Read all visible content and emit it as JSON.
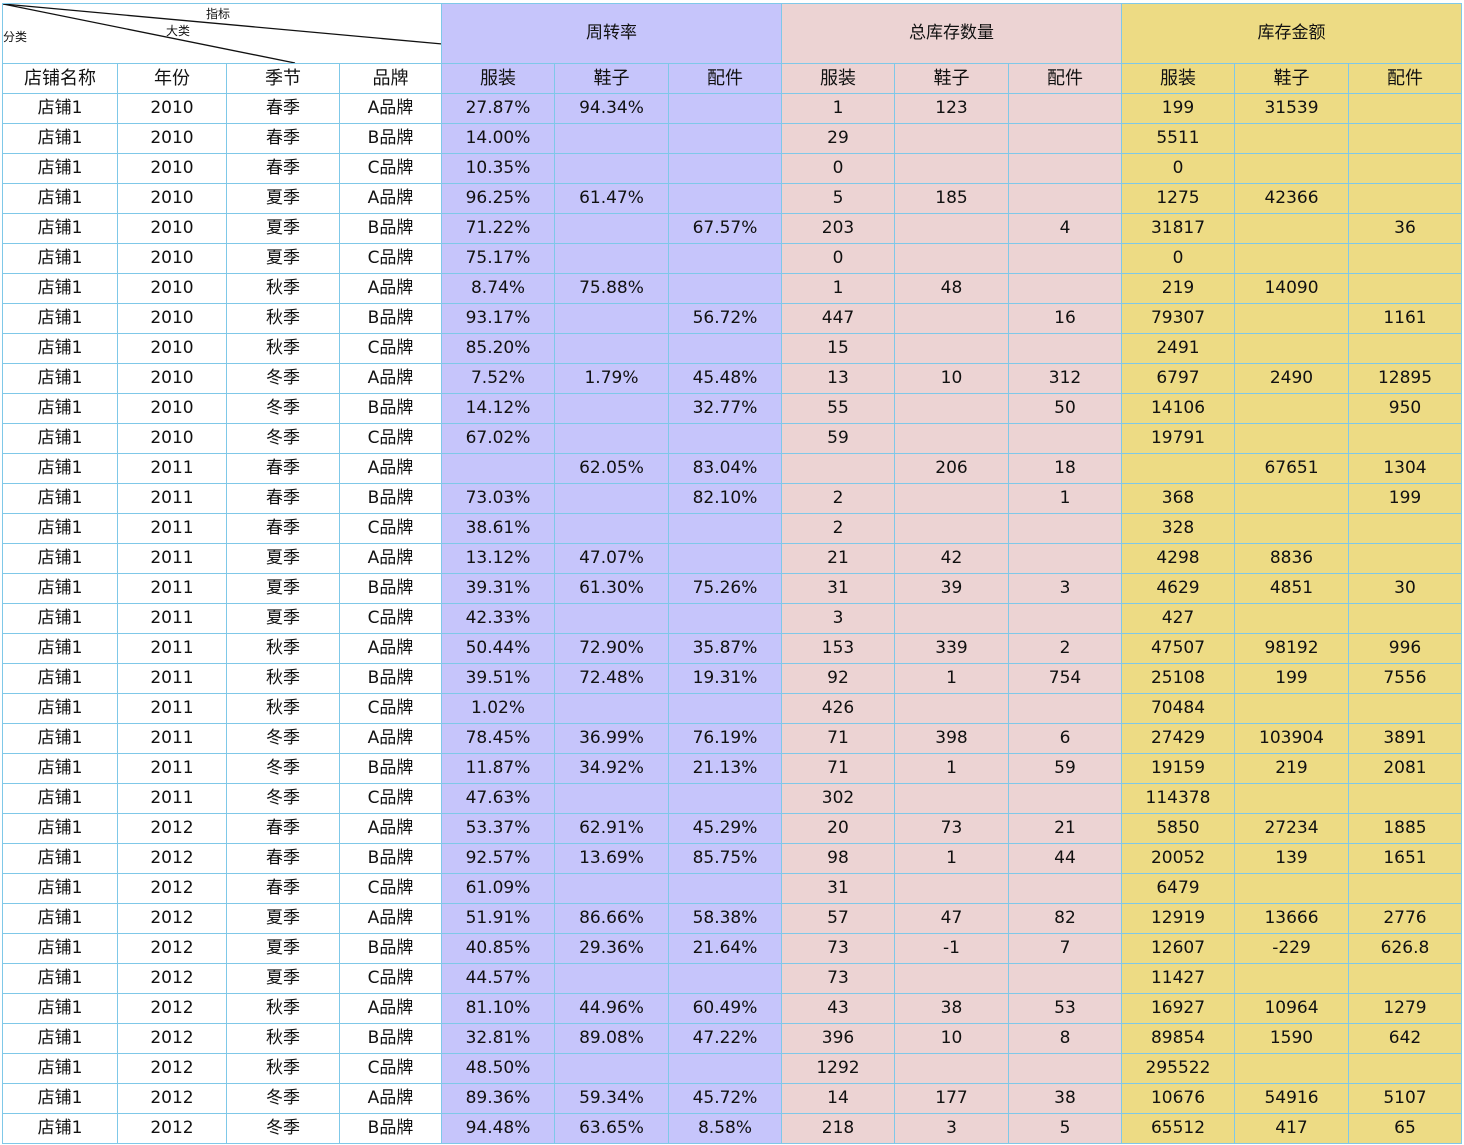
{
  "header": {
    "corner": {
      "zhibiao": "指标",
      "dalei": "大类",
      "fenlei": "分类"
    },
    "groups": [
      "周转率",
      "总库存数量",
      "库存金额"
    ],
    "dims": [
      "店铺名称",
      "年份",
      "季节",
      "品牌"
    ],
    "subs": [
      "服装",
      "鞋子",
      "配件",
      "服装",
      "鞋子",
      "配件",
      "服装",
      "鞋子",
      "配件"
    ]
  },
  "rows": [
    [
      "店铺1",
      "2010",
      "春季",
      "A品牌",
      "27.87%",
      "94.34%",
      "",
      "1",
      "123",
      "",
      "199",
      "31539",
      ""
    ],
    [
      "店铺1",
      "2010",
      "春季",
      "B品牌",
      "14.00%",
      "",
      "",
      "29",
      "",
      "",
      "5511",
      "",
      ""
    ],
    [
      "店铺1",
      "2010",
      "春季",
      "C品牌",
      "10.35%",
      "",
      "",
      "0",
      "",
      "",
      "0",
      "",
      ""
    ],
    [
      "店铺1",
      "2010",
      "夏季",
      "A品牌",
      "96.25%",
      "61.47%",
      "",
      "5",
      "185",
      "",
      "1275",
      "42366",
      ""
    ],
    [
      "店铺1",
      "2010",
      "夏季",
      "B品牌",
      "71.22%",
      "",
      "67.57%",
      "203",
      "",
      "4",
      "31817",
      "",
      "36"
    ],
    [
      "店铺1",
      "2010",
      "夏季",
      "C品牌",
      "75.17%",
      "",
      "",
      "0",
      "",
      "",
      "0",
      "",
      ""
    ],
    [
      "店铺1",
      "2010",
      "秋季",
      "A品牌",
      "8.74%",
      "75.88%",
      "",
      "1",
      "48",
      "",
      "219",
      "14090",
      ""
    ],
    [
      "店铺1",
      "2010",
      "秋季",
      "B品牌",
      "93.17%",
      "",
      "56.72%",
      "447",
      "",
      "16",
      "79307",
      "",
      "1161"
    ],
    [
      "店铺1",
      "2010",
      "秋季",
      "C品牌",
      "85.20%",
      "",
      "",
      "15",
      "",
      "",
      "2491",
      "",
      ""
    ],
    [
      "店铺1",
      "2010",
      "冬季",
      "A品牌",
      "7.52%",
      "1.79%",
      "45.48%",
      "13",
      "10",
      "312",
      "6797",
      "2490",
      "12895"
    ],
    [
      "店铺1",
      "2010",
      "冬季",
      "B品牌",
      "14.12%",
      "",
      "32.77%",
      "55",
      "",
      "50",
      "14106",
      "",
      "950"
    ],
    [
      "店铺1",
      "2010",
      "冬季",
      "C品牌",
      "67.02%",
      "",
      "",
      "59",
      "",
      "",
      "19791",
      "",
      ""
    ],
    [
      "店铺1",
      "2011",
      "春季",
      "A品牌",
      "",
      "62.05%",
      "83.04%",
      "",
      "206",
      "18",
      "",
      "67651",
      "1304"
    ],
    [
      "店铺1",
      "2011",
      "春季",
      "B品牌",
      "73.03%",
      "",
      "82.10%",
      "2",
      "",
      "1",
      "368",
      "",
      "199"
    ],
    [
      "店铺1",
      "2011",
      "春季",
      "C品牌",
      "38.61%",
      "",
      "",
      "2",
      "",
      "",
      "328",
      "",
      ""
    ],
    [
      "店铺1",
      "2011",
      "夏季",
      "A品牌",
      "13.12%",
      "47.07%",
      "",
      "21",
      "42",
      "",
      "4298",
      "8836",
      ""
    ],
    [
      "店铺1",
      "2011",
      "夏季",
      "B品牌",
      "39.31%",
      "61.30%",
      "75.26%",
      "31",
      "39",
      "3",
      "4629",
      "4851",
      "30"
    ],
    [
      "店铺1",
      "2011",
      "夏季",
      "C品牌",
      "42.33%",
      "",
      "",
      "3",
      "",
      "",
      "427",
      "",
      ""
    ],
    [
      "店铺1",
      "2011",
      "秋季",
      "A品牌",
      "50.44%",
      "72.90%",
      "35.87%",
      "153",
      "339",
      "2",
      "47507",
      "98192",
      "996"
    ],
    [
      "店铺1",
      "2011",
      "秋季",
      "B品牌",
      "39.51%",
      "72.48%",
      "19.31%",
      "92",
      "1",
      "754",
      "25108",
      "199",
      "7556"
    ],
    [
      "店铺1",
      "2011",
      "秋季",
      "C品牌",
      "1.02%",
      "",
      "",
      "426",
      "",
      "",
      "70484",
      "",
      ""
    ],
    [
      "店铺1",
      "2011",
      "冬季",
      "A品牌",
      "78.45%",
      "36.99%",
      "76.19%",
      "71",
      "398",
      "6",
      "27429",
      "103904",
      "3891"
    ],
    [
      "店铺1",
      "2011",
      "冬季",
      "B品牌",
      "11.87%",
      "34.92%",
      "21.13%",
      "71",
      "1",
      "59",
      "19159",
      "219",
      "2081"
    ],
    [
      "店铺1",
      "2011",
      "冬季",
      "C品牌",
      "47.63%",
      "",
      "",
      "302",
      "",
      "",
      "114378",
      "",
      ""
    ],
    [
      "店铺1",
      "2012",
      "春季",
      "A品牌",
      "53.37%",
      "62.91%",
      "45.29%",
      "20",
      "73",
      "21",
      "5850",
      "27234",
      "1885"
    ],
    [
      "店铺1",
      "2012",
      "春季",
      "B品牌",
      "92.57%",
      "13.69%",
      "85.75%",
      "98",
      "1",
      "44",
      "20052",
      "139",
      "1651"
    ],
    [
      "店铺1",
      "2012",
      "春季",
      "C品牌",
      "61.09%",
      "",
      "",
      "31",
      "",
      "",
      "6479",
      "",
      ""
    ],
    [
      "店铺1",
      "2012",
      "夏季",
      "A品牌",
      "51.91%",
      "86.66%",
      "58.38%",
      "57",
      "47",
      "82",
      "12919",
      "13666",
      "2776"
    ],
    [
      "店铺1",
      "2012",
      "夏季",
      "B品牌",
      "40.85%",
      "29.36%",
      "21.64%",
      "73",
      "-1",
      "7",
      "12607",
      "-229",
      "626.8"
    ],
    [
      "店铺1",
      "2012",
      "夏季",
      "C品牌",
      "44.57%",
      "",
      "",
      "73",
      "",
      "",
      "11427",
      "",
      ""
    ],
    [
      "店铺1",
      "2012",
      "秋季",
      "A品牌",
      "81.10%",
      "44.96%",
      "60.49%",
      "43",
      "38",
      "53",
      "16927",
      "10964",
      "1279"
    ],
    [
      "店铺1",
      "2012",
      "秋季",
      "B品牌",
      "32.81%",
      "89.08%",
      "47.22%",
      "396",
      "10",
      "8",
      "89854",
      "1590",
      "642"
    ],
    [
      "店铺1",
      "2012",
      "秋季",
      "C品牌",
      "48.50%",
      "",
      "",
      "1292",
      "",
      "",
      "295522",
      "",
      ""
    ],
    [
      "店铺1",
      "2012",
      "冬季",
      "A品牌",
      "89.36%",
      "59.34%",
      "45.72%",
      "14",
      "177",
      "38",
      "10676",
      "54916",
      "5107"
    ],
    [
      "店铺1",
      "2012",
      "冬季",
      "B品牌",
      "94.48%",
      "63.65%",
      "8.58%",
      "218",
      "3",
      "5",
      "65512",
      "417",
      "65"
    ]
  ],
  "colors": {
    "turnover": "#c6c5fb",
    "quantity": "#ecd3d3",
    "amount": "#eddb84",
    "grid": "#7fc8e8"
  }
}
